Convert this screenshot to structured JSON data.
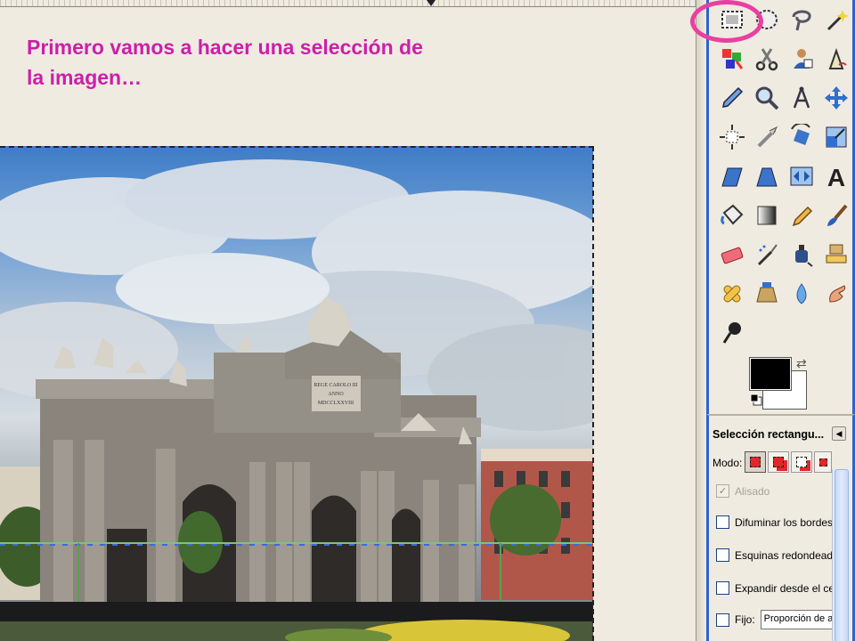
{
  "caption": {
    "line1": "Primero vamos a hacer una selección de",
    "line2": "la imagen…"
  },
  "image": {
    "inscription": [
      "REGE CAROLO III",
      "ANNO",
      "MDCCLXXVIII"
    ]
  },
  "toolbox": {
    "tools": [
      {
        "name": "rect-select-tool",
        "icon": "rectangle-select-icon",
        "active": true
      },
      {
        "name": "ellipse-select-tool",
        "icon": "ellipse-select-icon"
      },
      {
        "name": "free-select-tool",
        "icon": "lasso-icon"
      },
      {
        "name": "fuzzy-select-tool",
        "icon": "magic-wand-icon"
      },
      {
        "name": "color-select-tool",
        "icon": "select-by-color-icon"
      },
      {
        "name": "scissors-tool",
        "icon": "scissors-icon"
      },
      {
        "name": "foreground-select-tool",
        "icon": "foreground-select-icon"
      },
      {
        "name": "paths-tool",
        "icon": "paths-pen-icon"
      },
      {
        "name": "color-picker-tool",
        "icon": "eyedropper-icon"
      },
      {
        "name": "zoom-tool",
        "icon": "magnifier-icon"
      },
      {
        "name": "measure-tool",
        "icon": "compass-icon"
      },
      {
        "name": "move-tool",
        "icon": "move-arrows-icon"
      },
      {
        "name": "align-tool",
        "icon": "align-icon"
      },
      {
        "name": "crop-tool",
        "icon": "crop-knife-icon"
      },
      {
        "name": "rotate-tool",
        "icon": "rotate-icon"
      },
      {
        "name": "scale-tool",
        "icon": "scale-icon"
      },
      {
        "name": "shear-tool",
        "icon": "shear-icon"
      },
      {
        "name": "perspective-tool",
        "icon": "perspective-icon"
      },
      {
        "name": "flip-tool",
        "icon": "flip-icon"
      },
      {
        "name": "text-tool",
        "icon": "text-a-icon"
      },
      {
        "name": "bucket-fill-tool",
        "icon": "paint-bucket-icon"
      },
      {
        "name": "blend-tool",
        "icon": "gradient-icon"
      },
      {
        "name": "pencil-tool",
        "icon": "pencil-icon"
      },
      {
        "name": "paintbrush-tool",
        "icon": "paintbrush-icon"
      },
      {
        "name": "eraser-tool",
        "icon": "eraser-icon"
      },
      {
        "name": "airbrush-tool",
        "icon": "airbrush-icon"
      },
      {
        "name": "ink-tool",
        "icon": "ink-bottle-icon"
      },
      {
        "name": "clone-tool",
        "icon": "clone-stamp-icon"
      },
      {
        "name": "heal-tool",
        "icon": "bandage-icon"
      },
      {
        "name": "perspective-clone-tool",
        "icon": "perspective-clone-icon"
      },
      {
        "name": "blur-sharpen-tool",
        "icon": "water-drop-icon"
      },
      {
        "name": "smudge-tool",
        "icon": "smudge-finger-icon"
      },
      {
        "name": "dodge-burn-tool",
        "icon": "dodge-burn-icon"
      }
    ],
    "colors": {
      "foreground": "#000000",
      "background": "#ffffff"
    }
  },
  "options": {
    "title": "Selección rectangu...",
    "mode_label": "Modo:",
    "antialias_label": "Alisado",
    "feather_label": "Difuminar los bordes",
    "rounded_label": "Esquinas redondeada",
    "expand_label": "Expandir desde el cer",
    "fixed_label": "Fijo:",
    "fixed_value": "Proporción de a"
  },
  "colors": {
    "accent_ring": "#ea3fa0",
    "caption": "#cc1fa8",
    "window_border": "#2c63d0"
  }
}
